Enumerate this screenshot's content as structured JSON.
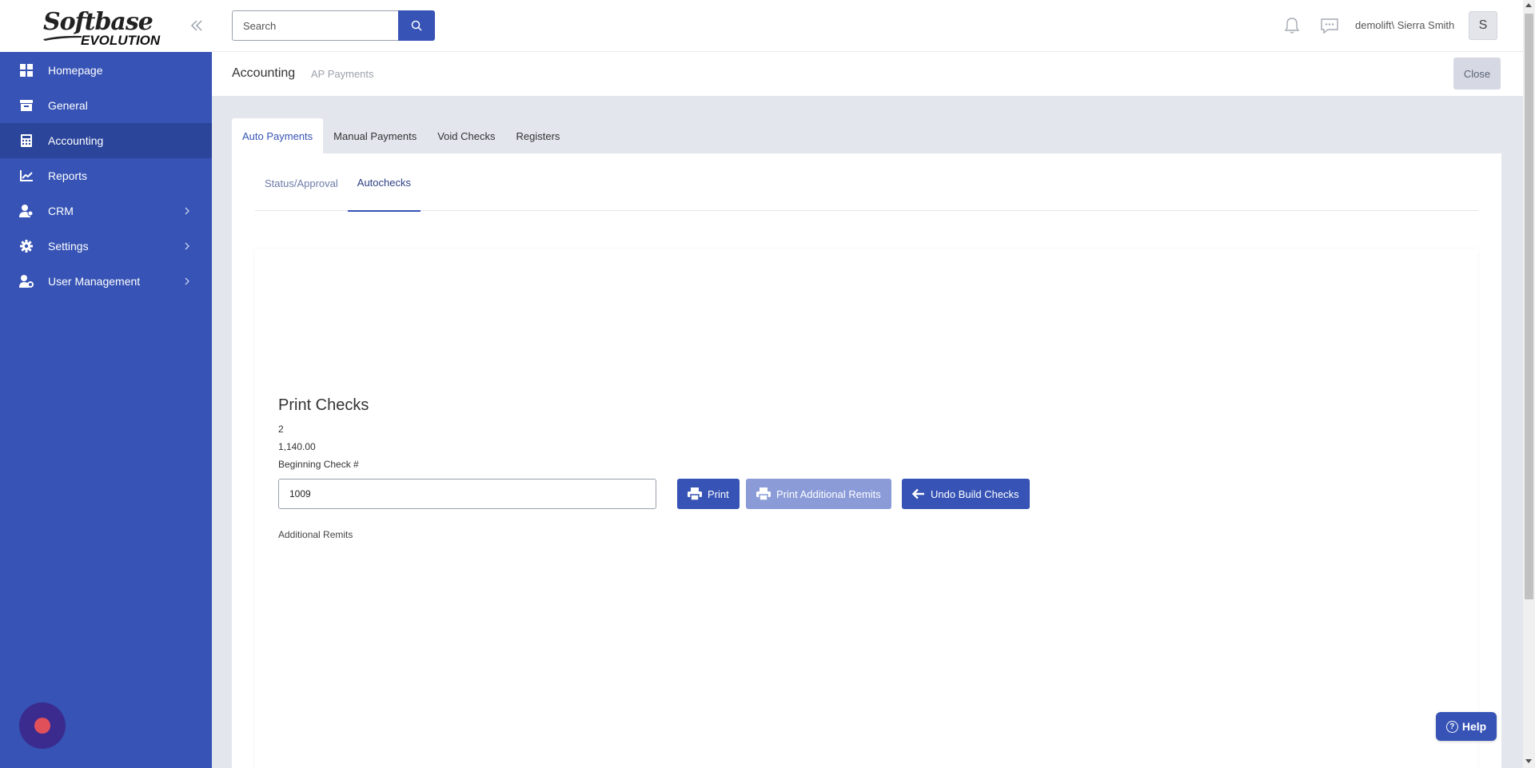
{
  "brand": {
    "logo_line1": "Softbase",
    "logo_line2": "EVOLUTION"
  },
  "sidebar": {
    "items": [
      {
        "label": "Homepage",
        "icon": "grid-icon",
        "active": false,
        "has_children": false
      },
      {
        "label": "General",
        "icon": "archive-box-icon",
        "active": false,
        "has_children": false
      },
      {
        "label": "Accounting",
        "icon": "calculator-icon",
        "active": true,
        "has_children": false
      },
      {
        "label": "Reports",
        "icon": "line-chart-icon",
        "active": false,
        "has_children": false
      },
      {
        "label": "CRM",
        "icon": "people-icon",
        "active": false,
        "has_children": true
      },
      {
        "label": "Settings",
        "icon": "gear-icon",
        "active": false,
        "has_children": true
      },
      {
        "label": "User Management",
        "icon": "user-gear-icon",
        "active": false,
        "has_children": true
      }
    ]
  },
  "topbar": {
    "search_placeholder": "Search",
    "user_name": "demolift\\ Sierra Smith",
    "avatar_initial": "S"
  },
  "header": {
    "title": "Accounting",
    "subtitle": "AP Payments",
    "close_label": "Close"
  },
  "tabs": [
    {
      "label": "Auto Payments",
      "active": true
    },
    {
      "label": "Manual Payments",
      "active": false
    },
    {
      "label": "Void Checks",
      "active": false
    },
    {
      "label": "Registers",
      "active": false
    }
  ],
  "subtabs": [
    {
      "label": "Status/Approval",
      "active": false
    },
    {
      "label": "Autochecks",
      "active": true
    }
  ],
  "print_checks": {
    "title": "Print Checks",
    "count": "2",
    "amount": "1,140.00",
    "beginning_check_label": "Beginning Check #",
    "beginning_check_value": "1009",
    "print_label": "Print",
    "print_remits_label": "Print Additional Remits",
    "undo_label": "Undo Build Checks",
    "additional_remits_label": "Additional Remits"
  },
  "help_label": "Help",
  "colors": {
    "primary": "#3653b5",
    "sidebar_active": "#2b459b",
    "disabled_button": "#8a9bd8",
    "content_bg": "#e4e6ee"
  }
}
